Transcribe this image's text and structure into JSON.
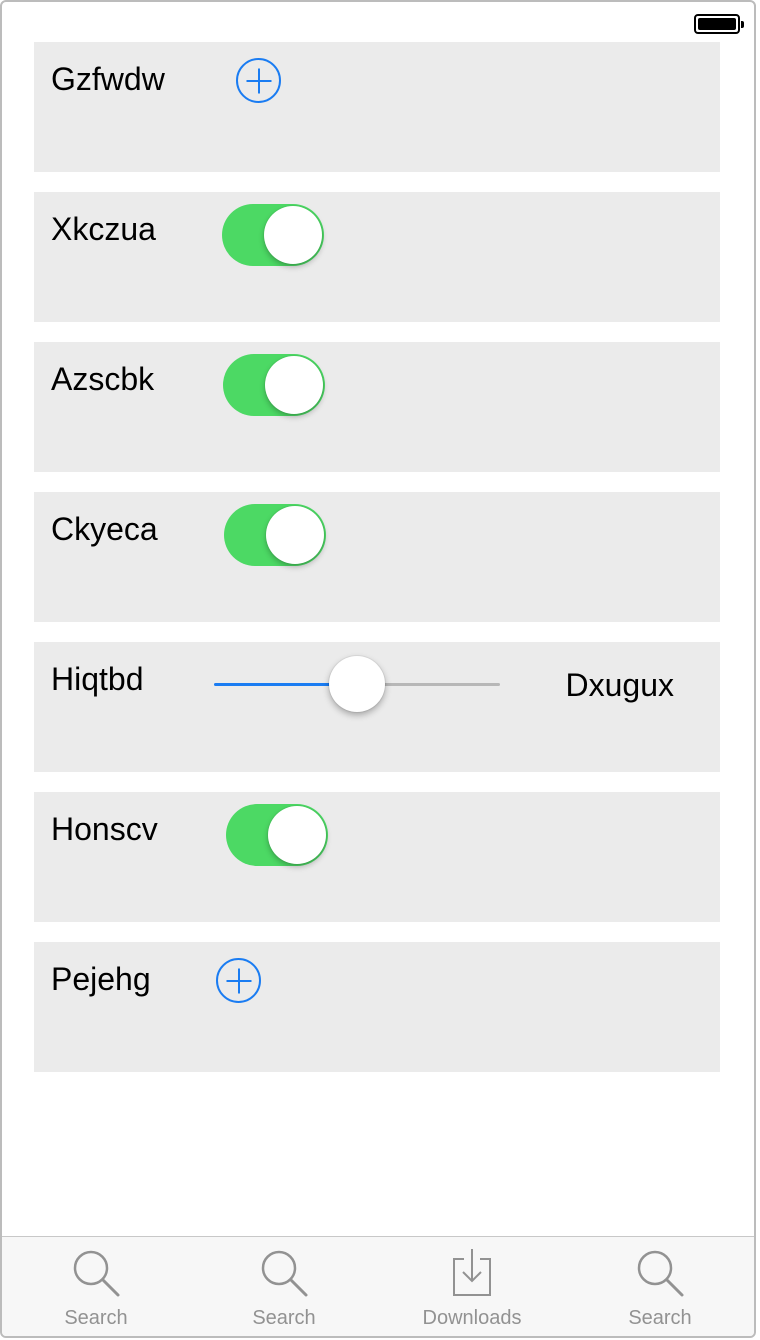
{
  "rows": [
    {
      "label": "Gzfwdw",
      "control": "add"
    },
    {
      "label": "Xkczua",
      "control": "toggle",
      "on": true
    },
    {
      "label": "Azscbk",
      "control": "toggle",
      "on": true
    },
    {
      "label": "Ckyeca",
      "control": "toggle",
      "on": true
    },
    {
      "label": "Hiqtbd",
      "control": "slider",
      "value_label": "Dxugux",
      "value": 0.5
    },
    {
      "label": "Honscv",
      "control": "toggle",
      "on": true
    },
    {
      "label": "Pejehg",
      "control": "add"
    }
  ],
  "tab_bar": {
    "tabs": [
      {
        "label": "Search",
        "icon": "search-icon"
      },
      {
        "label": "Search",
        "icon": "search-icon"
      },
      {
        "label": "Downloads",
        "icon": "download-icon"
      },
      {
        "label": "Search",
        "icon": "search-icon"
      }
    ]
  },
  "colors": {
    "accent": "#1a7cf2",
    "toggle_on": "#4cd964",
    "row_background": "#ebebeb",
    "tab_label": "#929292"
  }
}
